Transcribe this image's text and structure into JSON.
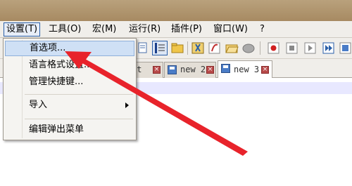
{
  "menubar": {
    "items": [
      "设置(T)",
      "工具(O)",
      "宏(M)",
      "运行(R)",
      "插件(P)",
      "窗口(W)",
      "?"
    ]
  },
  "dropdown": {
    "items": [
      "首选项...",
      "语言格式设置...",
      "管理快捷键...",
      "导入",
      "编辑弹出菜单"
    ]
  },
  "tabs": [
    {
      "label": "xt",
      "state": "inactive"
    },
    {
      "label": "new 2",
      "state": "inactive"
    },
    {
      "label": "new 3",
      "state": "active"
    }
  ],
  "toolbar": {
    "icons": [
      "doc-icon",
      "indent-guide-icon",
      "folder-icon",
      "bookmark-icon",
      "function-icon",
      "folder-open-icon",
      "settings-icon",
      "record-icon",
      "stop-icon",
      "play-icon",
      "play-multiple-icon",
      "save-macro-icon"
    ]
  },
  "colors": {
    "accent": "#2a5fa8",
    "annotation_arrow": "#e8232b",
    "highlight": "#cfe0f5"
  }
}
